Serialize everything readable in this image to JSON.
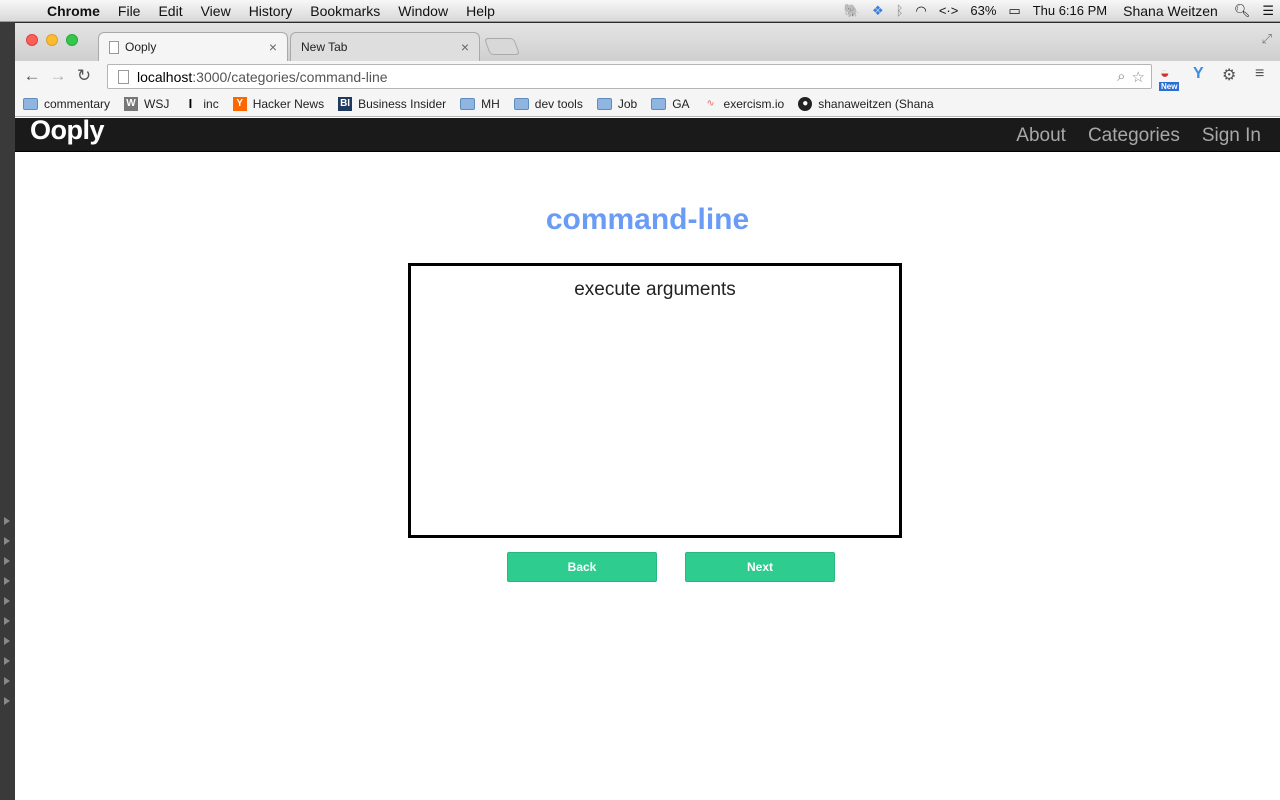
{
  "menubar": {
    "app": "Chrome",
    "items": [
      "File",
      "Edit",
      "View",
      "History",
      "Bookmarks",
      "Window",
      "Help"
    ],
    "battery": "63%",
    "clock": "Thu 6:16 PM",
    "user": "Shana Weitzen"
  },
  "browser": {
    "tabs": [
      {
        "title": "Ooply",
        "active": true
      },
      {
        "title": "New Tab",
        "active": false
      }
    ],
    "url_host": "localhost",
    "url_path": ":3000/categories/command-line",
    "extension_badge": "New",
    "bookmarks": [
      {
        "label": "commentary",
        "icon": "folder-icon"
      },
      {
        "label": "WSJ",
        "icon": "wsj-icon"
      },
      {
        "label": "inc",
        "icon": "inc-icon"
      },
      {
        "label": "Hacker News",
        "icon": "hacker-news-icon"
      },
      {
        "label": "Business Insider",
        "icon": "business-insider-icon"
      },
      {
        "label": "MH",
        "icon": "folder-icon"
      },
      {
        "label": "dev tools",
        "icon": "folder-icon"
      },
      {
        "label": "Job",
        "icon": "folder-icon"
      },
      {
        "label": "GA",
        "icon": "folder-icon"
      },
      {
        "label": "exercism.io",
        "icon": "exercism-icon"
      },
      {
        "label": "shanaweitzen (Shana",
        "icon": "github-icon"
      }
    ]
  },
  "site": {
    "brand": "Ooply",
    "nav": [
      "About",
      "Categories",
      "Sign In"
    ],
    "page_title": "command-line",
    "card_text": "execute arguments",
    "back_label": "Back",
    "next_label": "Next",
    "accent": "#6a9cf5",
    "button_color": "#2ecc8f"
  }
}
